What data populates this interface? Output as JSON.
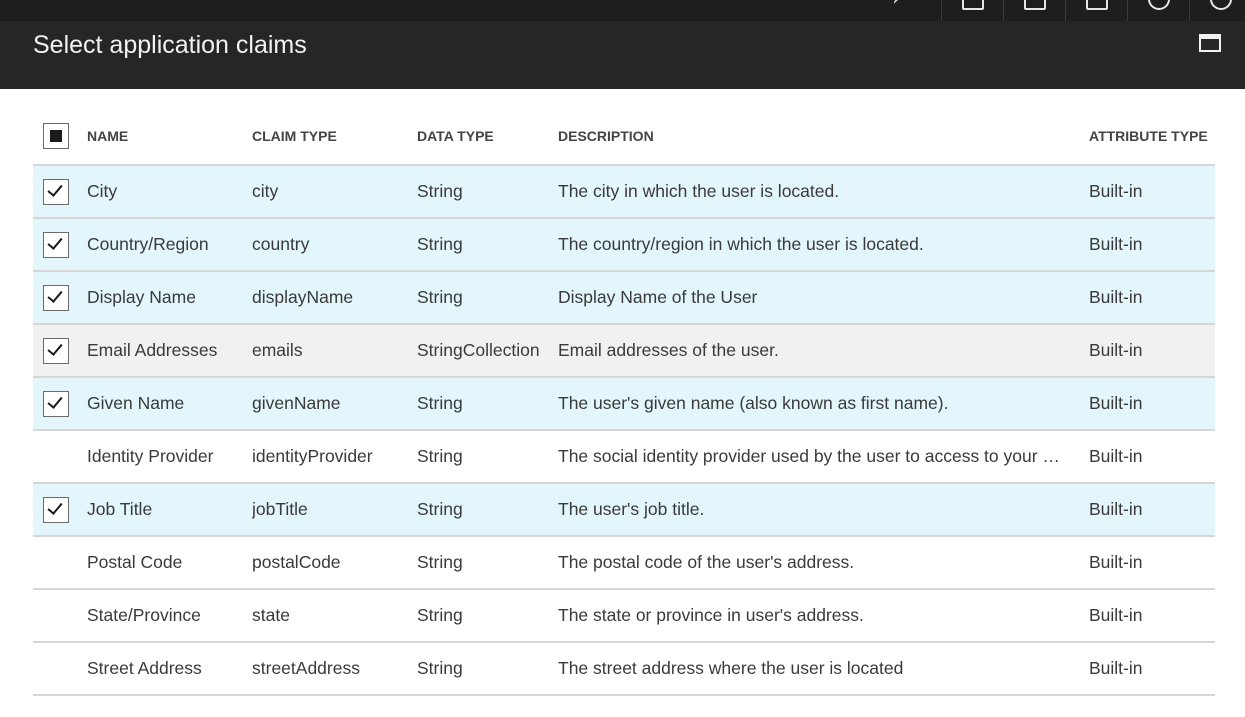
{
  "header": {
    "title": "Select application claims"
  },
  "icons": {
    "maximize": "maximize-icon",
    "select_all": "partial-select-icon",
    "checked": "checkmark-icon"
  },
  "colors": {
    "selected_row": "#e2f6fb",
    "hover_row": "#f1f1f1",
    "header_bg": "#262626"
  },
  "table": {
    "columns": {
      "name": "NAME",
      "claim_type": "CLAIM TYPE",
      "data_type": "DATA TYPE",
      "description": "DESCRIPTION",
      "attribute_type": "ATTRIBUTE TYPE"
    },
    "rows": [
      {
        "checked": true,
        "name": "City",
        "claim_type": "city",
        "data_type": "String",
        "description": "The city in which the user is located.",
        "attribute_type": "Built-in"
      },
      {
        "checked": true,
        "name": "Country/Region",
        "claim_type": "country",
        "data_type": "String",
        "description": "The country/region in which the user is located.",
        "attribute_type": "Built-in"
      },
      {
        "checked": true,
        "name": "Display Name",
        "claim_type": "displayName",
        "data_type": "String",
        "description": "Display Name of the User",
        "attribute_type": "Built-in"
      },
      {
        "checked": true,
        "name": "Email Addresses",
        "claim_type": "emails",
        "data_type": "StringCollection",
        "description": "Email addresses of the user.",
        "attribute_type": "Built-in"
      },
      {
        "checked": true,
        "name": "Given Name",
        "claim_type": "givenName",
        "data_type": "String",
        "description": "The user's given name (also known as first name).",
        "attribute_type": "Built-in"
      },
      {
        "checked": false,
        "name": "Identity Provider",
        "claim_type": "identityProvider",
        "data_type": "String",
        "description": "The social identity provider used by the user to access to your …",
        "attribute_type": "Built-in"
      },
      {
        "checked": true,
        "name": "Job Title",
        "claim_type": "jobTitle",
        "data_type": "String",
        "description": "The user's job title.",
        "attribute_type": "Built-in"
      },
      {
        "checked": false,
        "name": "Postal Code",
        "claim_type": "postalCode",
        "data_type": "String",
        "description": "The postal code of the user's address.",
        "attribute_type": "Built-in"
      },
      {
        "checked": false,
        "name": "State/Province",
        "claim_type": "state",
        "data_type": "String",
        "description": "The state or province in user's address.",
        "attribute_type": "Built-in"
      },
      {
        "checked": false,
        "name": "Street Address",
        "claim_type": "streetAddress",
        "data_type": "String",
        "description": "The street address where the user is located",
        "attribute_type": "Built-in"
      }
    ]
  }
}
